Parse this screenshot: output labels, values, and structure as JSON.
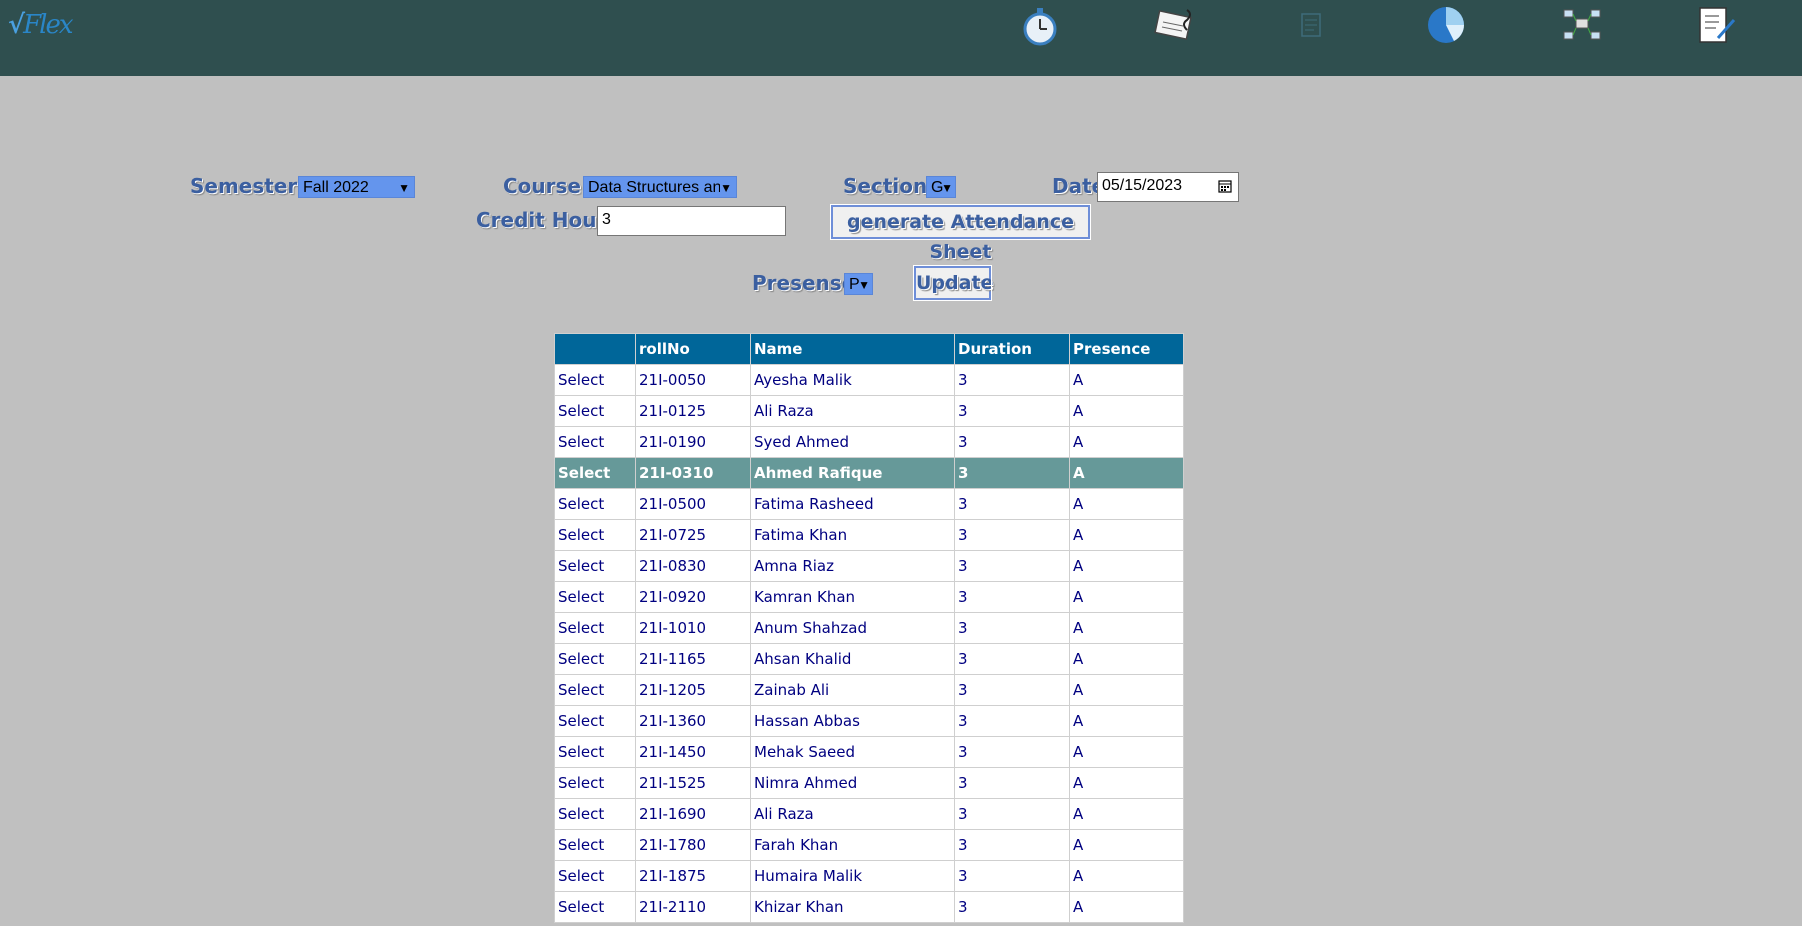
{
  "header": {
    "logo_text": "Flex",
    "icons": [
      "stopwatch-icon",
      "certificate-icon",
      "document-icon",
      "pie-chart-icon",
      "network-icon",
      "checklist-edit-icon"
    ]
  },
  "form": {
    "semester_label": "Semester",
    "semester_value": "Fall 2022",
    "course_label": "Course",
    "course_value": "Data Structures and",
    "section_label": "Section",
    "section_value": "G",
    "date_label": "Date",
    "date_value": "05/15/2023",
    "credit_hours_label": "Credit Hours",
    "credit_hours_value": "3",
    "generate_button": "generate Attendance Sheet",
    "presence_label": "Presense",
    "presence_value": "P",
    "update_button": "Update"
  },
  "table": {
    "headers": [
      "",
      "rollNo",
      "Name",
      "Duration",
      "Presence"
    ],
    "select_label": "Select",
    "highlighted_row": 3,
    "rows": [
      {
        "roll": "21I-0050",
        "name": "Ayesha Malik",
        "duration": "3",
        "presence": "A"
      },
      {
        "roll": "21I-0125",
        "name": "Ali Raza",
        "duration": "3",
        "presence": "A"
      },
      {
        "roll": "21I-0190",
        "name": "Syed Ahmed",
        "duration": "3",
        "presence": "A"
      },
      {
        "roll": "21I-0310",
        "name": "Ahmed Rafique",
        "duration": "3",
        "presence": "A"
      },
      {
        "roll": "21I-0500",
        "name": "Fatima Rasheed",
        "duration": "3",
        "presence": "A"
      },
      {
        "roll": "21I-0725",
        "name": "Fatima Khan",
        "duration": "3",
        "presence": "A"
      },
      {
        "roll": "21I-0830",
        "name": "Amna Riaz",
        "duration": "3",
        "presence": "A"
      },
      {
        "roll": "21I-0920",
        "name": "Kamran Khan",
        "duration": "3",
        "presence": "A"
      },
      {
        "roll": "21I-1010",
        "name": "Anum Shahzad",
        "duration": "3",
        "presence": "A"
      },
      {
        "roll": "21I-1165",
        "name": "Ahsan Khalid",
        "duration": "3",
        "presence": "A"
      },
      {
        "roll": "21I-1205",
        "name": "Zainab Ali",
        "duration": "3",
        "presence": "A"
      },
      {
        "roll": "21I-1360",
        "name": "Hassan Abbas",
        "duration": "3",
        "presence": "A"
      },
      {
        "roll": "21I-1450",
        "name": "Mehak Saeed",
        "duration": "3",
        "presence": "A"
      },
      {
        "roll": "21I-1525",
        "name": "Nimra Ahmed",
        "duration": "3",
        "presence": "A"
      },
      {
        "roll": "21I-1690",
        "name": "Ali Raza",
        "duration": "3",
        "presence": "A"
      },
      {
        "roll": "21I-1780",
        "name": "Farah Khan",
        "duration": "3",
        "presence": "A"
      },
      {
        "roll": "21I-1875",
        "name": "Humaira Malik",
        "duration": "3",
        "presence": "A"
      },
      {
        "roll": "21I-2110",
        "name": "Khizar Khan",
        "duration": "3",
        "presence": "A"
      }
    ]
  }
}
